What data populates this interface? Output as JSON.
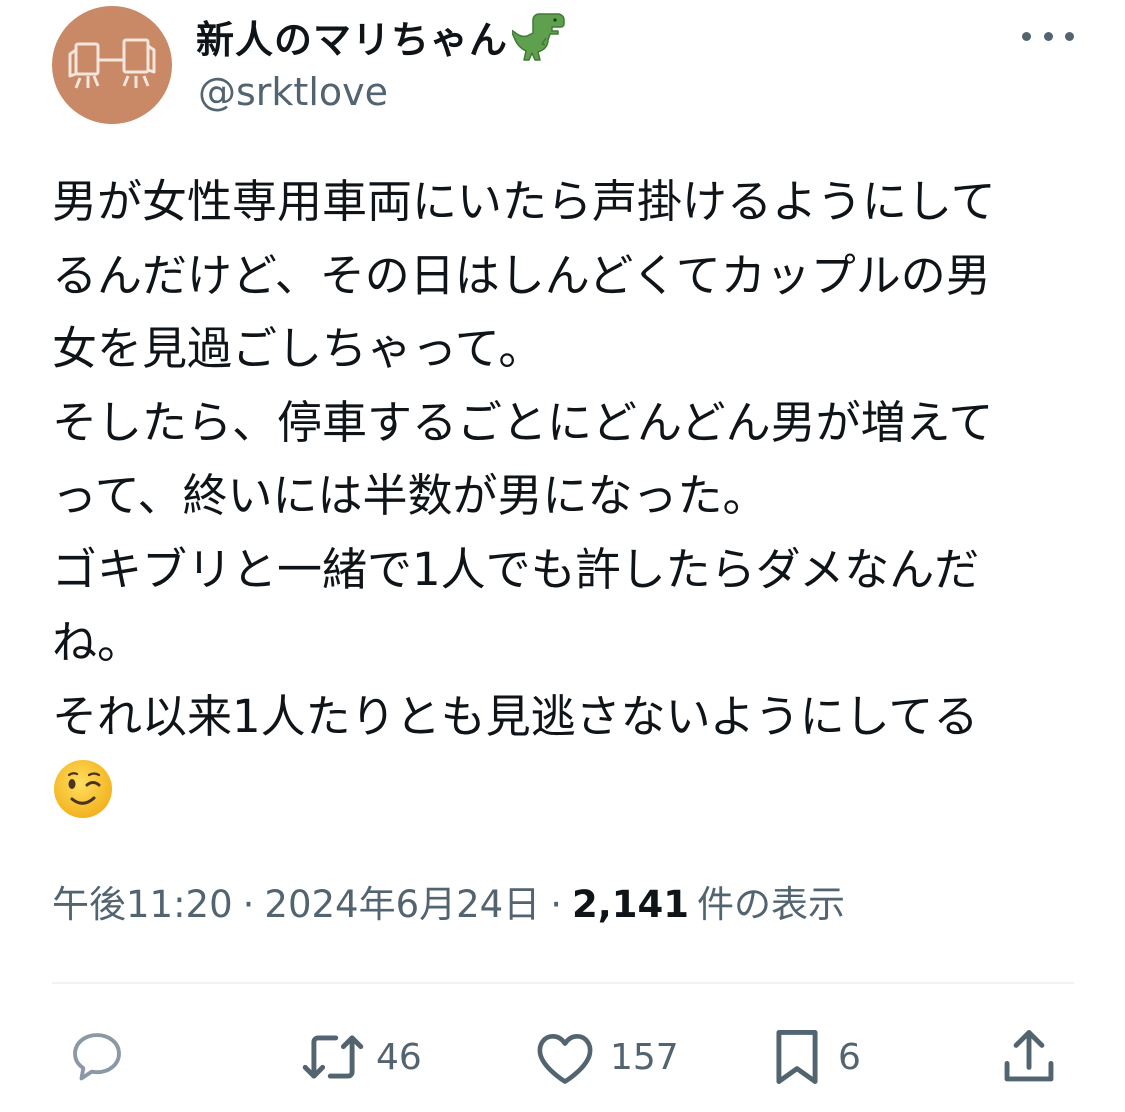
{
  "user": {
    "display_name": "新人のマリちゃん",
    "handle": "@srktlove",
    "name_emoji": "t-rex-icon"
  },
  "tweet": {
    "lines": [
      "男が女性専用車両にいたら声掛けるようにして",
      "るんだけど、その日はしんどくてカップルの男",
      "女を見過ごしちゃって。",
      "そしたら、停車するごとにどんどん男が増えて",
      "って、終いには半数が男になった。",
      "ゴキブリと一緒で1人でも許したらダメなんだ",
      "ね。",
      "それ以来1人たりとも見逃さないようにしてる"
    ],
    "trailing_emoji": "winking-face-icon"
  },
  "meta": {
    "time": "午後11:20",
    "separator": "·",
    "date": "2024年6月24日",
    "views_count": "2,141",
    "views_label": "件の表示"
  },
  "actions": {
    "reply_count": "",
    "retweet_count": "46",
    "like_count": "157",
    "bookmark_count": "6"
  },
  "colors": {
    "text": "#0f1419",
    "secondary": "#536471",
    "avatar_bg": "#c98866",
    "divider": "#eff3f4"
  }
}
